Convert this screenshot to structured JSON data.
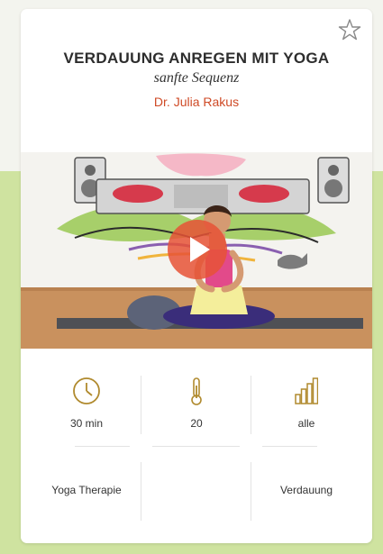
{
  "session": {
    "title": "VERDAUUNG ANREGEN MIT YOGA",
    "subtitle": "sanfte Sequenz",
    "author": "Dr. Julia Rakus"
  },
  "stats": {
    "duration": "30 min",
    "intensity": "20",
    "level": "alle"
  },
  "tags": {
    "style": "Yoga Therapie",
    "focus": "",
    "topic": "Verdauung"
  },
  "icons": {
    "favorite": "star-outline-icon",
    "duration": "clock-icon",
    "intensity": "thermometer-icon",
    "level": "signal-bars-icon",
    "video": "play-icon"
  },
  "colors": {
    "accent": "#cf4a26",
    "icon_gold": "#b08a2e",
    "background_green": "#cfe3a0",
    "play_button": "#e65236"
  }
}
